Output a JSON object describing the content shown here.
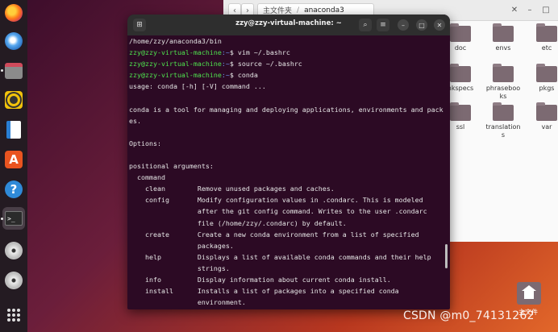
{
  "dock": {
    "items": [
      {
        "name": "firefox-icon"
      },
      {
        "name": "thunderbird-icon"
      },
      {
        "name": "files-icon"
      },
      {
        "name": "rhythmbox-icon"
      },
      {
        "name": "libreoffice-writer-icon"
      },
      {
        "name": "app-center-icon",
        "glyph": "A"
      },
      {
        "name": "help-icon",
        "glyph": "?"
      },
      {
        "name": "terminal-icon",
        "glyph": ">_"
      },
      {
        "name": "disc-icon"
      },
      {
        "name": "disc-icon-2"
      },
      {
        "name": "show-apps-icon"
      }
    ]
  },
  "file_manager": {
    "back_glyph": "‹",
    "forward_glyph": "›",
    "breadcrumb_home": "主文件夹",
    "breadcrumb_sep": "/",
    "breadcrumb_current": "anaconda3",
    "folders": [
      {
        "label": "doc"
      },
      {
        "label": "envs"
      },
      {
        "label": "etc"
      },
      {
        "label": "nkspecs"
      },
      {
        "label": "phraseboo ks"
      },
      {
        "label": "pkgs"
      },
      {
        "label": "ssl"
      },
      {
        "label": "translation s"
      },
      {
        "label": "var"
      }
    ]
  },
  "terminal": {
    "title": "zzy@zzy-virtual-machine: ~",
    "new_tab_glyph": "⊞",
    "search_glyph": "⌕",
    "menu_glyph": "≡",
    "minimize_glyph": "–",
    "maximize_glyph": "□",
    "close_glyph": "✕",
    "lines": [
      {
        "text": "/home/zzy/anaconda3/bin"
      },
      {
        "prompt": "zzy@zzy-virtual-machine",
        "path": ":~",
        "cmd": "$ vim ~/.bashrc"
      },
      {
        "prompt": "zzy@zzy-virtual-machine",
        "path": ":~",
        "cmd": "$ source ~/.bashrc"
      },
      {
        "prompt": "zzy@zzy-virtual-machine",
        "path": ":~",
        "cmd": "$ conda"
      },
      {
        "text": "usage: conda [-h] [-V] command ..."
      },
      {
        "text": ""
      },
      {
        "text": "conda is a tool for managing and deploying applications, environments and packag"
      },
      {
        "text": "es."
      },
      {
        "text": ""
      },
      {
        "text": "Options:"
      },
      {
        "text": ""
      },
      {
        "text": "positional arguments:"
      },
      {
        "text": "  command"
      },
      {
        "text": "    clean        Remove unused packages and caches."
      },
      {
        "text": "    config       Modify configuration values in .condarc. This is modeled"
      },
      {
        "text": "                 after the git config command. Writes to the user .condarc"
      },
      {
        "text": "                 file (/home/zzy/.condarc) by default."
      },
      {
        "text": "    create       Create a new conda environment from a list of specified"
      },
      {
        "text": "                 packages."
      },
      {
        "text": "    help         Displays a list of available conda commands and their help"
      },
      {
        "text": "                 strings."
      },
      {
        "text": "    info         Display information about current conda install."
      },
      {
        "text": "    install      Installs a list of packages into a specified conda"
      },
      {
        "text": "                 environment."
      }
    ]
  },
  "desktop": {
    "home_label": "主文件",
    "watermark": "CSDN @m0_74131262"
  }
}
